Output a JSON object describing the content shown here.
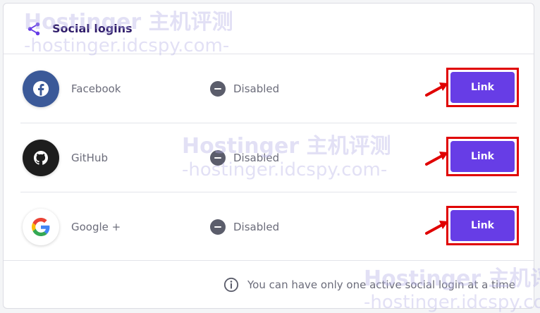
{
  "panel": {
    "title": "Social logins",
    "icon": "share-icon"
  },
  "providers": [
    {
      "name": "Facebook",
      "status": "Disabled",
      "action": "Link",
      "icon": "facebook-icon",
      "color": "#3b5998"
    },
    {
      "name": "GitHub",
      "status": "Disabled",
      "action": "Link",
      "icon": "github-icon",
      "color": "#1d1d1d"
    },
    {
      "name": "Google +",
      "status": "Disabled",
      "action": "Link",
      "icon": "google-icon",
      "color": "#ffffff"
    }
  ],
  "footer": {
    "note": "You can have only one active social login at a time",
    "icon": "info-icon"
  },
  "watermark": {
    "title": "Hostinger 主机评测",
    "subtitle": "-hostinger.idcspy.com-"
  },
  "colors": {
    "accent": "#673de6",
    "highlight": "#e00000",
    "title": "#2f1c6a"
  }
}
